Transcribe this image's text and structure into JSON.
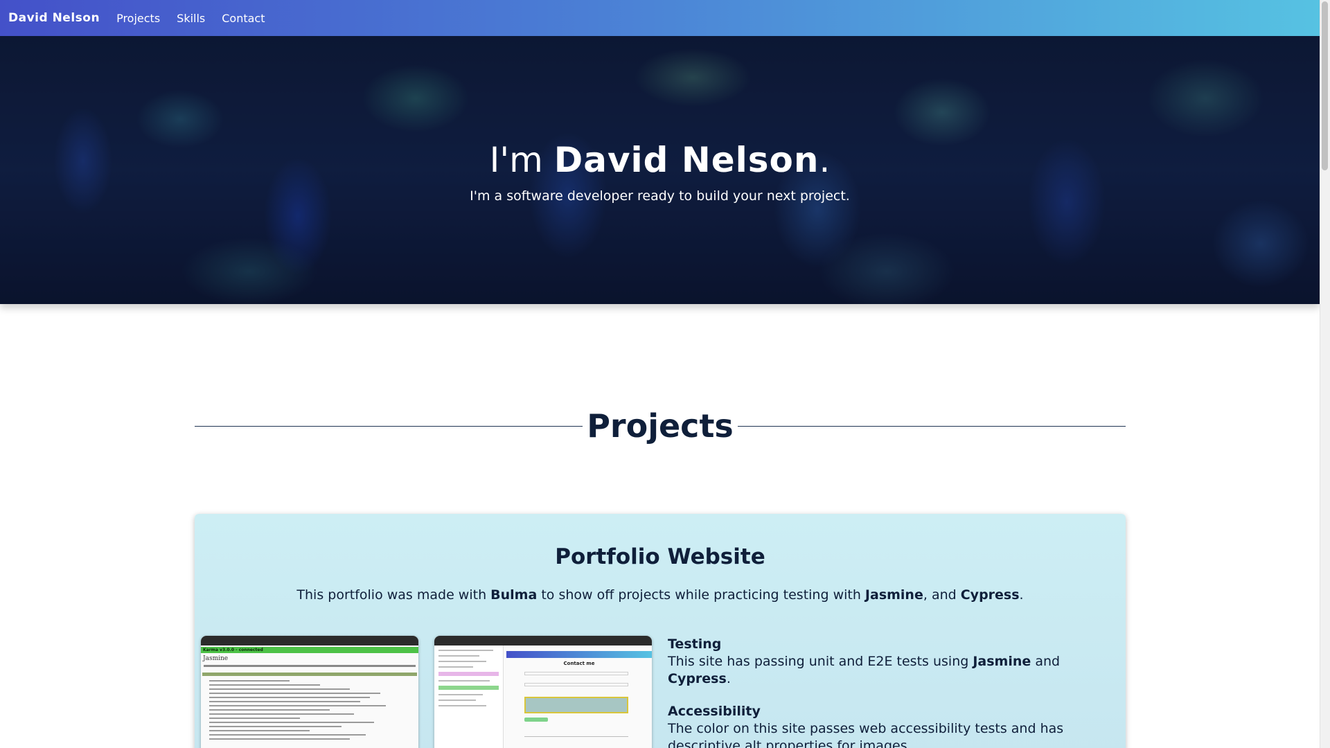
{
  "navbar": {
    "brand": "David Nelson",
    "links": [
      "Projects",
      "Skills",
      "Contact"
    ]
  },
  "hero": {
    "prefix": "I'm ",
    "name": "David Nelson",
    "suffix": ".",
    "subtitle": "I'm a software developer ready to build your next project."
  },
  "projects_section": {
    "title": "Projects"
  },
  "project": {
    "title": "Portfolio Website",
    "desc": {
      "p1": "This portfolio was made with ",
      "b1": "Bulma",
      "p2": " to show off projects while practicing testing with ",
      "b2": "Jasmine",
      "p3": ", and ",
      "b3": "Cypress",
      "p4": "."
    },
    "screenshot1": {
      "header": "Karma v3.0.0 - connected",
      "title": "Jasmine"
    },
    "screenshot2": {
      "title": "Contact me"
    },
    "features": {
      "testing": {
        "title": "Testing",
        "p1": "This site has passing unit and E2E tests using ",
        "b1": "Jasmine",
        "p2": " and ",
        "b2": "Cypress",
        "p3": "."
      },
      "accessibility": {
        "title": "Accessibility",
        "text": "The color on this site passes web accessibility tests and has descriptive alt properties for images."
      }
    }
  },
  "colors": {
    "navbar_start": "#4451c9",
    "navbar_end": "#56c2e2",
    "text_dark": "#0f1f3a",
    "card_bg": "#cdeef4"
  }
}
